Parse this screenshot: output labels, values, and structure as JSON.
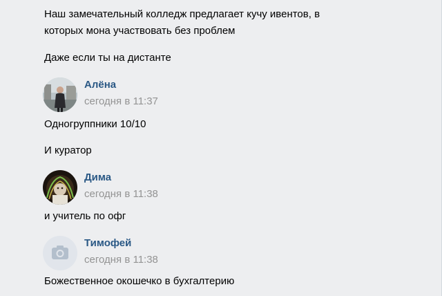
{
  "messages": {
    "m1_line1": "Наш замечательный колледж предлагает кучу ивентов, в",
    "m1_line2": "которых мона участвовать без проблем",
    "m2": "Даже если ты на дистанте"
  },
  "posts": [
    {
      "author": "Алёна",
      "time": "сегодня в 11:37",
      "avatar_icon": "user-photo-icon",
      "texts": [
        "Одногруппники 10/10",
        "И куратор"
      ]
    },
    {
      "author": "Дима",
      "time": "сегодня в 11:38",
      "avatar_icon": "user-photo-icon",
      "texts": [
        "и учитель по офг"
      ]
    },
    {
      "author": "Тимофей",
      "time": "сегодня в 11:38",
      "avatar_icon": "camera-icon",
      "texts": [
        "Божественное окошечко в бухгалтерию"
      ]
    }
  ],
  "colors": {
    "background": "#edeef0",
    "author_link": "#2a5885",
    "timestamp": "#939393",
    "text": "#000000"
  }
}
